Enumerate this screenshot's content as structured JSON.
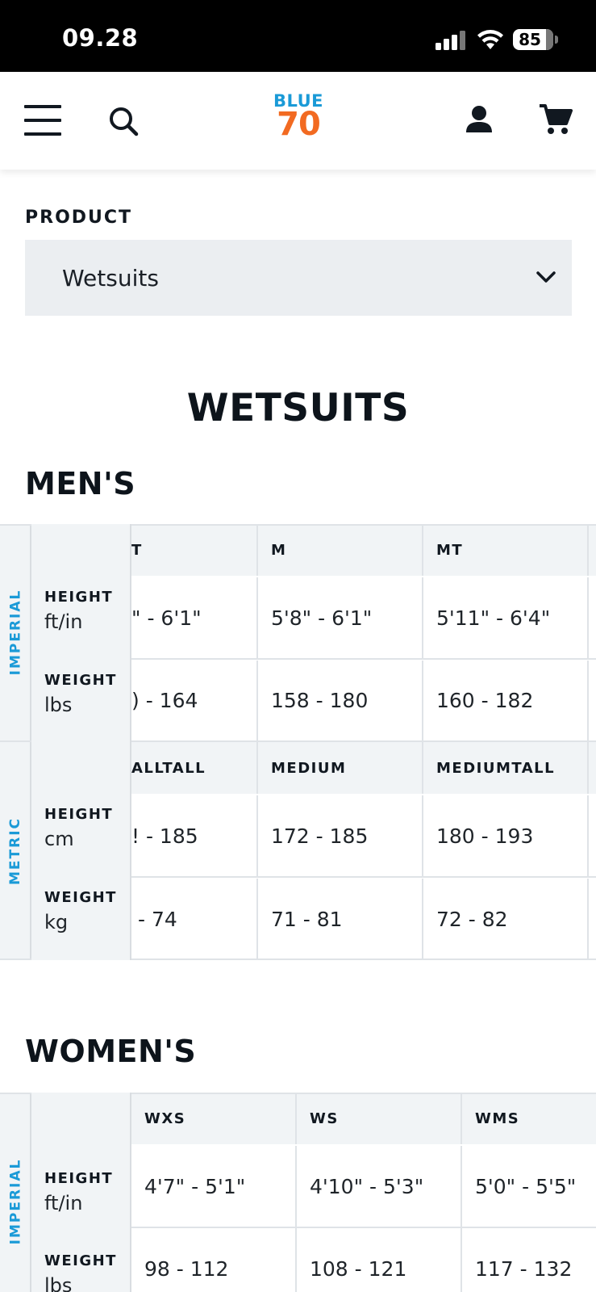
{
  "status_bar": {
    "time": "09.28",
    "battery": "85"
  },
  "header": {
    "logo_top": "BLUE",
    "logo_bottom": "70"
  },
  "product_selector": {
    "label": "PRODUCT",
    "value": "Wetsuits"
  },
  "page_title": "WETSUITS",
  "mens": {
    "title": "MEN'S",
    "imperial": {
      "unit_system": "IMPERIAL",
      "columns": [
        "T",
        "M",
        "MT"
      ],
      "height_label": "HEIGHT",
      "height_unit": "ft/in",
      "heights": [
        "\" - 6'1\"",
        "5'8\" - 6'1\"",
        "5'11\" - 6'4\""
      ],
      "weight_label": "WEIGHT",
      "weight_unit": "lbs",
      "weights": [
        ") - 164",
        "158 - 180",
        "160 - 182"
      ]
    },
    "metric": {
      "unit_system": "METRIC",
      "columns": [
        "ALLTALL",
        "MEDIUM",
        "MEDIUMTALL"
      ],
      "height_label": "HEIGHT",
      "height_unit": "cm",
      "heights": [
        "! - 185",
        "172 - 185",
        "180 - 193"
      ],
      "weight_label": "WEIGHT",
      "weight_unit": "kg",
      "weights": [
        "- 74",
        "71 - 81",
        "72 - 82"
      ]
    }
  },
  "womens": {
    "title": "WOMEN'S",
    "imperial": {
      "unit_system": "IMPERIAL",
      "columns": [
        "WXS",
        "WS",
        "WMS"
      ],
      "height_label": "HEIGHT",
      "height_unit": "ft/in",
      "heights": [
        "4'7\" - 5'1\"",
        "4'10\" - 5'3\"",
        "5'0\" - 5'5\""
      ],
      "weight_label": "WEIGHT",
      "weight_unit": "lbs",
      "weights": [
        "98 - 112",
        "108 - 121",
        "117 - 132"
      ]
    }
  },
  "colors": {
    "brand_blue": "#1a9ad7",
    "brand_orange": "#f26a21",
    "table_header_bg": "#f1f4f6",
    "select_bg": "#ebeef1"
  },
  "icons": [
    "menu-icon",
    "search-icon",
    "user-icon",
    "cart-icon",
    "chevron-down-icon",
    "signal-icon",
    "wifi-icon",
    "battery-icon"
  ]
}
